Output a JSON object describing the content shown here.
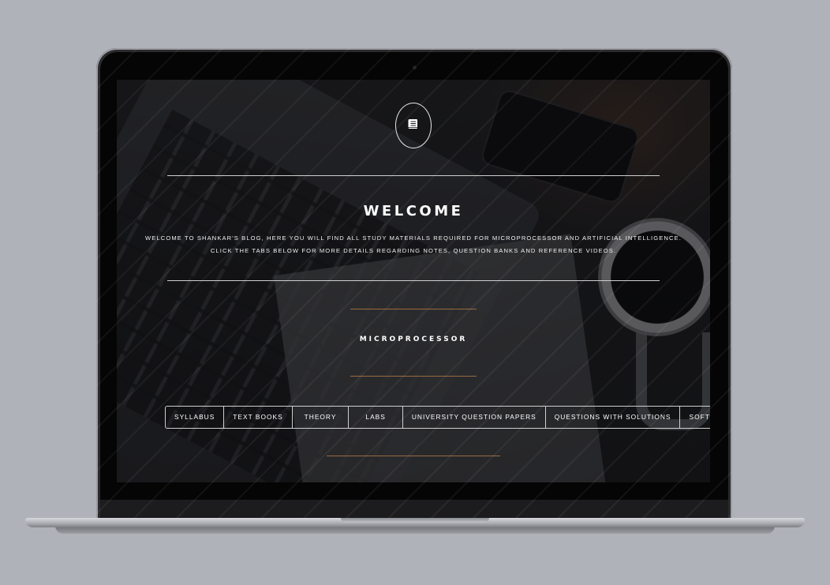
{
  "page": {
    "welcome_title": "WELCOME",
    "intro_line1": "WELCOME TO SHANKAR'S BLOG, HERE YOU WILL FIND ALL STUDY MATERIALS REQUIRED FOR MICROPROCESSOR AND ARTIFICIAL INTELLIGENCE.",
    "intro_line2": "CLICK THE TABS BELOW FOR MORE DETAILS REGARDING NOTES, QUESTION BANKS AND REFERENCE VIDEOS.",
    "section_title": "MICROPROCESSOR",
    "logo_icon": "book-icon"
  },
  "tabs": [
    {
      "label": "SYLLABUS"
    },
    {
      "label": "TEXT BOOKS"
    },
    {
      "label": "THEORY"
    },
    {
      "label": "LABS"
    },
    {
      "label": "UNIVERSITY QUESTION PAPERS"
    },
    {
      "label": "QUESTIONS WITH SOLUTIONS"
    },
    {
      "label": "SOFTWARES"
    }
  ],
  "colors": {
    "accent_line": "#9a6a42",
    "text": "#ffffff"
  }
}
